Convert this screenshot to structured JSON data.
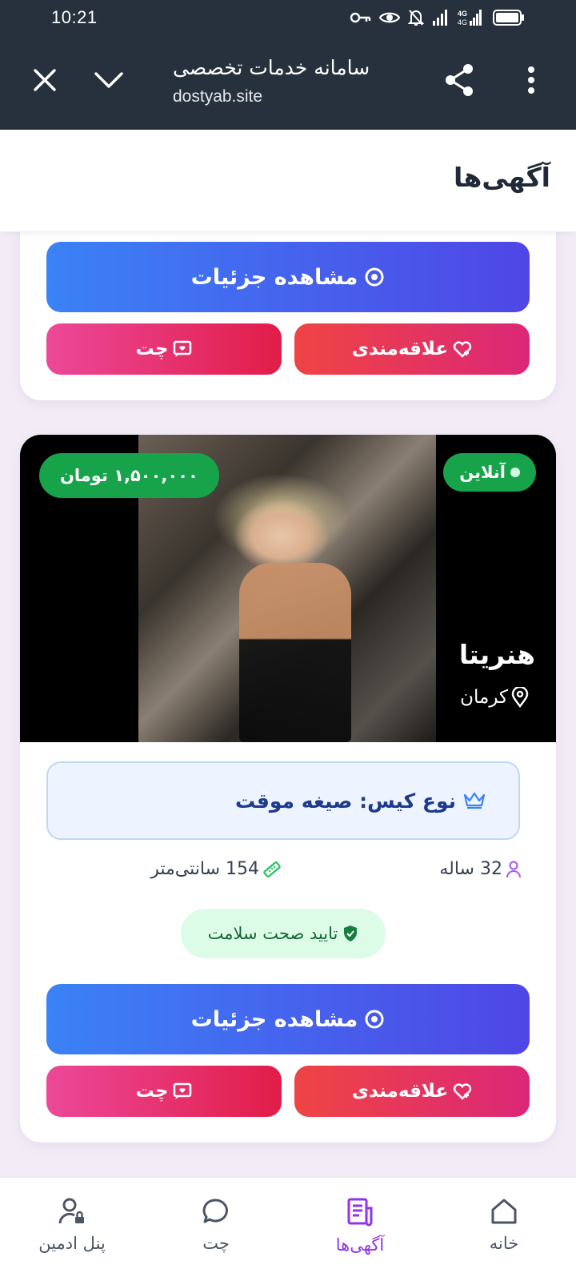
{
  "status_bar": {
    "time": "10:21",
    "icons": [
      "vpn-key-icon",
      "eye-icon",
      "bell-off-icon",
      "signal-icon",
      "signal-4g-icon",
      "battery-icon"
    ]
  },
  "custom_tab": {
    "title": "سامانه خدمات تخصصی",
    "url": "dostyab.site",
    "icons": [
      "close-icon",
      "chevron-down-icon",
      "share-icon",
      "more-vert-icon"
    ]
  },
  "app_bar": {
    "title": "آگهی‌ها"
  },
  "previous_card": {
    "details_label": "مشاهده جزئیات",
    "chat_label": "چت",
    "favorite_label": "علاقه‌مندی"
  },
  "listing": {
    "status": "آنلاین",
    "price": "۱,۵۰۰,۰۰۰ تومان",
    "name": "هنریتا",
    "city": "کرمان",
    "case_type": "نوع کیس: صیغه موقت",
    "age": "32 ساله",
    "height": "154 سانتی‌متر",
    "health": "تایید صحت سلامت",
    "details_label": "مشاهده جزئیات",
    "chat_label": "چت",
    "favorite_label": "علاقه‌مندی"
  },
  "colors": {
    "primary_gradient_start": "#3b82f6",
    "primary_gradient_end": "#4f46e5",
    "chat_gradient": "#e11d48",
    "online_green": "#16a34a",
    "active_nav": "#9333ea"
  },
  "bottom_nav": {
    "items": [
      {
        "label": "خانه",
        "icon": "home-icon",
        "active": false
      },
      {
        "label": "آگهی‌ها",
        "icon": "ads-list-icon",
        "active": true
      },
      {
        "label": "چت",
        "icon": "chat-bubble-icon",
        "active": false
      },
      {
        "label": "پنل ادمین",
        "icon": "admin-user-icon",
        "active": false
      }
    ]
  }
}
